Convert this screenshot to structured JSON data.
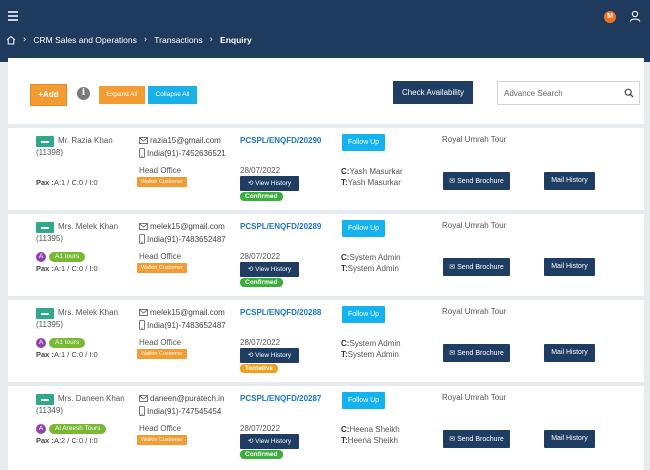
{
  "header": {
    "avatar_initial": "M",
    "accent_color": "#f37021",
    "bg_color": "#1e3a5c"
  },
  "breadcrumb": {
    "items": [
      "CRM Sales and Operations",
      "Transactions",
      "Enquiry"
    ]
  },
  "toolbar": {
    "add_label": "+Add",
    "info_label": "i",
    "expand_label": "Expand All",
    "collapse_label": "Collapse All",
    "check_label": "Check Availability",
    "search_placeholder": "Advance Search"
  },
  "enquiries": [
    {
      "name": "Mr. Razia Khan",
      "id": "(11398)",
      "email": "razia15@gmail.com",
      "phone": "India(91)-7452636521",
      "enquiry_no": "PCSPL/ENQFD/20290",
      "follow_label": "Follow Up",
      "tour": "Royal Umrah Tour",
      "agent_initial": "",
      "agent_name": "",
      "pax_label": "Pax :",
      "pax_value": "A:1 / C:0 / I:0",
      "office": "Head Office",
      "source": "Walkin Customer",
      "date": "28/07/2022",
      "view_label": "View History",
      "status": "Confirmed",
      "c_label": "C:",
      "c_value": "Yash Masurkar",
      "t_label": "T:",
      "t_value": "Yash Masurkar",
      "brochure_label": "Send Brochure",
      "mail_label": "Mail History"
    },
    {
      "name": "Mrs. Melek Khan",
      "id": "(11395)",
      "email": "melek15@gmail.com",
      "phone": "India(91)-7483652487",
      "enquiry_no": "PCSPL/ENQFD/20289",
      "follow_label": "Follow Up",
      "tour": "Royal Umrah Tour",
      "agent_initial": "A",
      "agent_name": "A1 tours",
      "pax_label": "Pax :",
      "pax_value": "A:1 / C:0 / I:0",
      "office": "Head Office",
      "source": "Walkin Customer",
      "date": "28/07/2022",
      "view_label": "View History",
      "status": "Confirmed",
      "c_label": "C:",
      "c_value": "System Admin",
      "t_label": "T:",
      "t_value": "System Admin",
      "brochure_label": "Send Brochure",
      "mail_label": "Mail History"
    },
    {
      "name": "Mrs. Melek Khan",
      "id": "(11395)",
      "email": "melek15@gmail.com",
      "phone": "India(91)-7483652487",
      "enquiry_no": "PCSPL/ENQFD/20288",
      "follow_label": "Follow Up",
      "tour": "Royal Umrah Tour",
      "agent_initial": "A",
      "agent_name": "A1 tours",
      "pax_label": "Pax :",
      "pax_value": "A:1 / C:0 / I:0",
      "office": "Head Office",
      "source": "Walkin Customer",
      "date": "28/07/2022",
      "view_label": "View History",
      "status": "Tentative",
      "c_label": "C:",
      "c_value": "System Admin",
      "t_label": "T:",
      "t_value": "System Admin",
      "brochure_label": "Send Brochure",
      "mail_label": "Mail History"
    },
    {
      "name": "Mrs. Daneen Khan",
      "id": "(11349)",
      "email": "daneen@puratech.in",
      "phone": "India(91)-747545454",
      "enquiry_no": "PCSPL/ENQFD/20287",
      "follow_label": "Follow Up",
      "tour": "Royal Umrah Tour",
      "agent_initial": "A",
      "agent_name": "Al Areesh Tours",
      "pax_label": "Pax :",
      "pax_value": "A:2 / C:0 / I:0",
      "office": "Head Office",
      "source": "Walkin Customer",
      "date": "28/07/2022",
      "view_label": "View History",
      "status": "Confirmed",
      "c_label": "C:",
      "c_value": "Heena Sheikh",
      "t_label": "T:",
      "t_value": "Heena Sheikh",
      "brochure_label": "Send Brochure",
      "mail_label": "Mail History"
    }
  ]
}
